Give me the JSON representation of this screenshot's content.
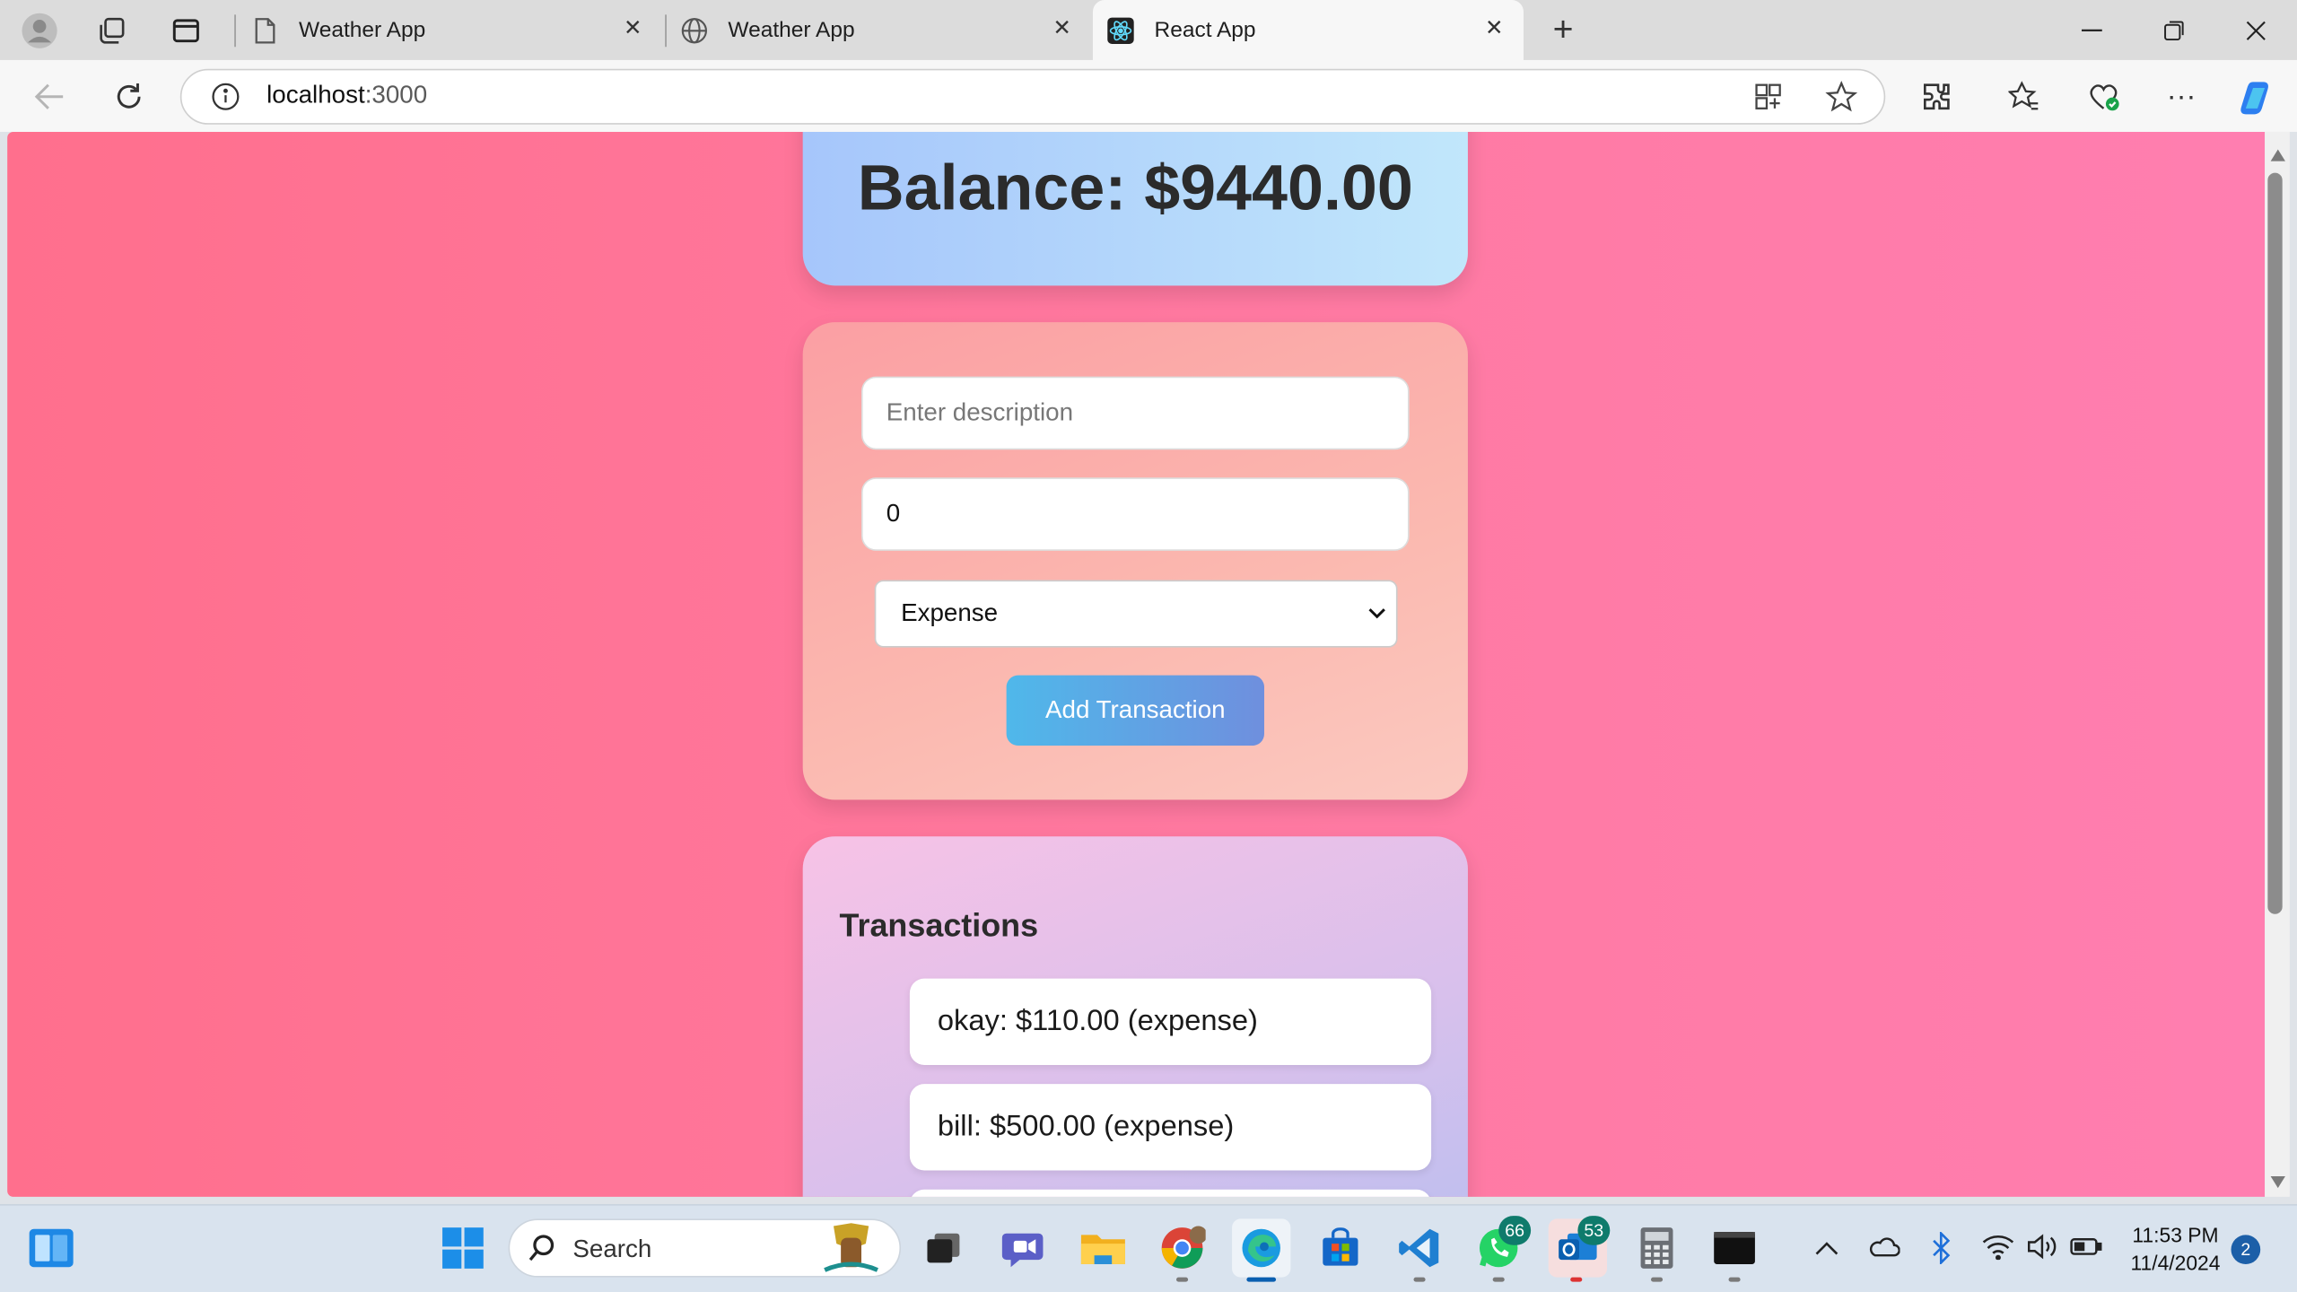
{
  "browser": {
    "tabs": [
      {
        "title": "Weather App",
        "icon": "page-icon",
        "active": false
      },
      {
        "title": "Weather App",
        "icon": "globe-icon",
        "active": false
      },
      {
        "title": "React App",
        "icon": "react-icon",
        "active": true
      }
    ],
    "url_host": "localhost",
    "url_port": ":3000"
  },
  "page": {
    "balance_text": "Balance: $9440.00",
    "form": {
      "description_placeholder": "Enter description",
      "amount_value": "0",
      "type_selected": "Expense",
      "add_button_label": "Add Transaction"
    },
    "transactions": {
      "title": "Transactions",
      "items": [
        "okay: $110.00 (expense)",
        "bill: $500.00 (expense)"
      ]
    }
  },
  "taskbar": {
    "search_label": "Search",
    "whatsapp_badge": "66",
    "outlook_badge": "53",
    "time": "11:53 PM",
    "date": "11/4/2024",
    "notification_count": "2"
  },
  "colors": {
    "page_bg": "#ff7297",
    "balance_card": "#b4d7fb",
    "form_card": "#fbb3ad",
    "transactions_card": "#d8c0ec",
    "button": "#5ea4e4"
  }
}
